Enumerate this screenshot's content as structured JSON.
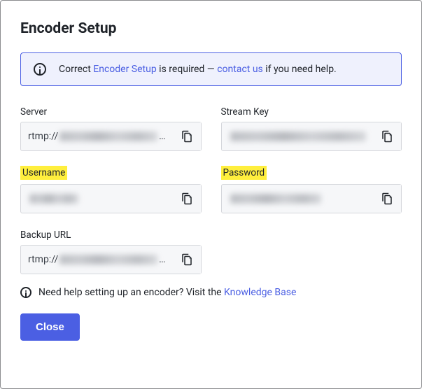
{
  "title": "Encoder Setup",
  "alert": {
    "pre": "Correct ",
    "link1": "Encoder Setup",
    "mid": " is required — ",
    "link2": "contact us",
    "post": " if you need help."
  },
  "fields": {
    "server": {
      "label": "Server",
      "prefix": "rtmp://",
      "value_hidden": true,
      "ellipsis": "…"
    },
    "streamkey": {
      "label": "Stream Key",
      "prefix": "",
      "value_hidden": true
    },
    "username": {
      "label": "Username",
      "prefix": "",
      "value_hidden": true
    },
    "password": {
      "label": "Password",
      "prefix": "",
      "value_hidden": true
    },
    "backup": {
      "label": "Backup URL",
      "prefix": "rtmp://",
      "value_hidden": true,
      "ellipsis": "…"
    }
  },
  "footer": {
    "text": "Need help setting up an encoder? Visit the ",
    "link": "Knowledge Base"
  },
  "close": "Close"
}
